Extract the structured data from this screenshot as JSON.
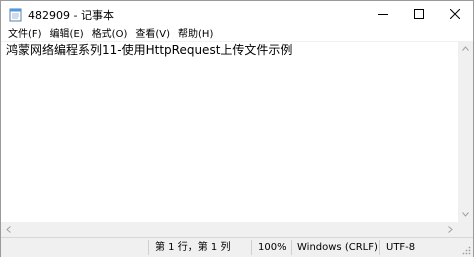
{
  "window": {
    "title": "482909 - 记事本",
    "app_icon": "notepad-icon"
  },
  "caption": {
    "minimize_icon": "minimize-icon",
    "maximize_icon": "maximize-icon",
    "close_icon": "close-icon"
  },
  "menu": {
    "items": [
      {
        "label": "文件(F)"
      },
      {
        "label": "编辑(E)"
      },
      {
        "label": "格式(O)"
      },
      {
        "label": "查看(V)"
      },
      {
        "label": "帮助(H)"
      }
    ]
  },
  "editor": {
    "content": "鸿蒙网络编程系列11-使用HttpRequest上传文件示例"
  },
  "statusbar": {
    "position": "第 1 行，第 1 列",
    "zoom": "100%",
    "line_ending": "Windows (CRLF)",
    "encoding": "UTF-8"
  },
  "colors": {
    "chrome_bg": "#f0f0f0",
    "editor_bg": "#ffffff",
    "text": "#000000"
  }
}
